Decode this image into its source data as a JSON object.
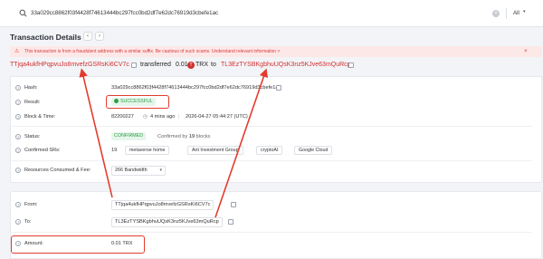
{
  "search": {
    "query": "33a029cc8862f03f4428f74613444bc297fcc0bd2df7e62dc76919d3cbefe1ac",
    "clear_glyph": "×",
    "scope_label": "All",
    "scope_chevron": "▾"
  },
  "header": {
    "title": "Transaction Details",
    "prev_glyph": "‹",
    "next_glyph": "›"
  },
  "warning": {
    "icon": "⚠",
    "text": "This transaction is from a fraudulent address with a similar suffix. Be cautious of such scams. Understand relevant information >",
    "close_glyph": "×"
  },
  "summary": {
    "from": "TTjqa4ukfHPqpvuJo8mvefzGSRsKi6CV7c",
    "verb": "transferred",
    "amount": "0.01",
    "coin_glyph": "T",
    "token": "TRX",
    "to_word": "to",
    "to": "TL3EzTYSBKgbhuUQsK3nz5KJve63mQuRcp"
  },
  "details": {
    "hash_label": "Hash:",
    "hash": "33a029cc8862f03f4428f74613444bc297fcc0bd2df7e62dc76919d3cbefe1ac",
    "result_label": "Result:",
    "result": "SUCCESSFUL",
    "block_label": "Block & Time:",
    "block": "82200227",
    "time_ago": "4 mins ago",
    "timestamp": "2026-04-27 05:44:27 (UTC)",
    "status_label": "Status:",
    "status": "CONFIRMED",
    "confirmed_by_prefix": "Confirmed by",
    "confirmed_by_count": "19",
    "confirmed_by_suffix": "blocks",
    "srs_label": "Confirmed SRs:",
    "srs_count": "19",
    "srs": [
      "metaverse home",
      "Ant Investment Group",
      "cryptoAI",
      "Google Cloud"
    ],
    "resources_label": "Resources Consumed & Fee:",
    "resources_value": "266 Bandwidth",
    "resources_chevron": "▾"
  },
  "transfer": {
    "from_label": "From:",
    "from": "TTjqa4ukfHPqpvuJo8mvefzGSRsKi6CV7c",
    "to_label": "To:",
    "to": "TL3EzTYSBKgbhuUQsK3nz5KJve63mQuRcp",
    "amount_label": "Amount:",
    "amount": "0.01 TRX"
  },
  "help_glyph": "?",
  "colors": {
    "accent_red": "#d32f2f",
    "success_green": "#2f9e4a",
    "annotation_red": "#e33b2e"
  }
}
